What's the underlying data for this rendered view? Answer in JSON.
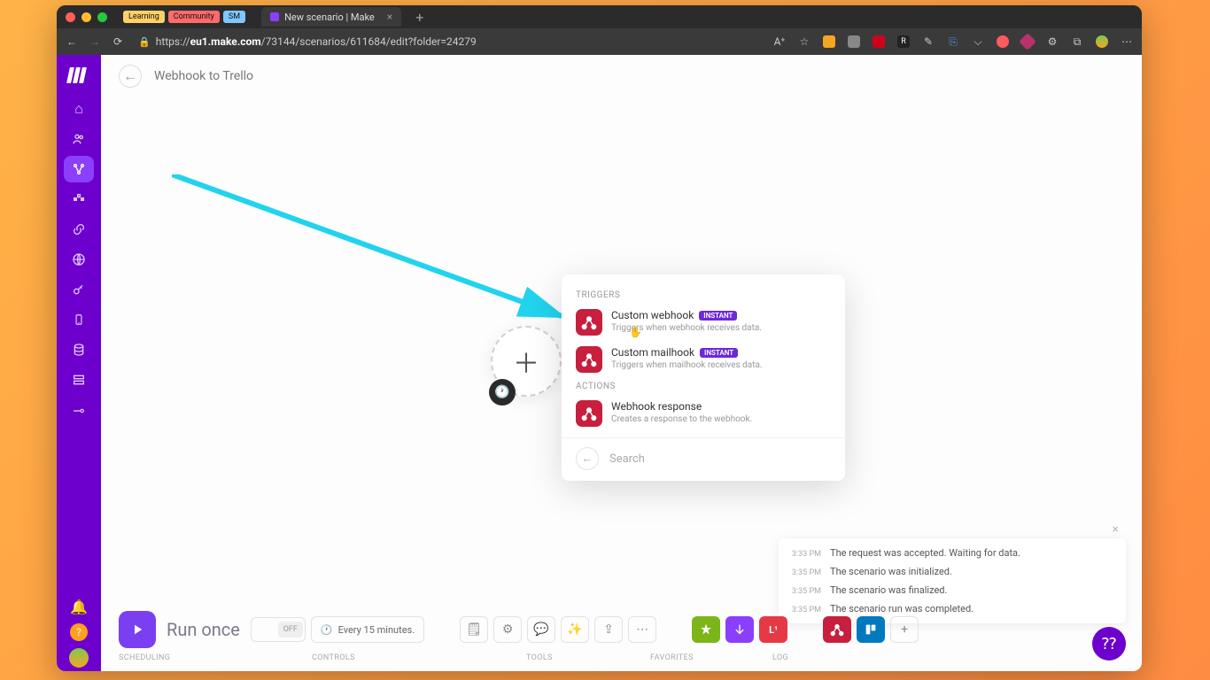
{
  "browser": {
    "bookmarks": [
      "Learning",
      "Community",
      "SM"
    ],
    "tab_title": "New scenario | Make",
    "url_prefix": "https://",
    "url_host": "eu1.make.com",
    "url_path": "/73144/scenarios/611684/edit?folder=24279"
  },
  "header": {
    "title": "Webhook to Trello"
  },
  "popup": {
    "section_triggers": "TRIGGERS",
    "section_actions": "ACTIONS",
    "badge": "INSTANT",
    "items": [
      {
        "title": "Custom webhook",
        "desc": "Triggers when webhook receives data.",
        "instant": true
      },
      {
        "title": "Custom mailhook",
        "desc": "Triggers when mailhook receives data.",
        "instant": true
      },
      {
        "title": "Webhook response",
        "desc": "Creates a response to the webhook.",
        "instant": false
      }
    ],
    "search": "Search"
  },
  "bottom": {
    "run": "Run once",
    "off": "OFF",
    "schedule": "Every 15 minutes.",
    "labels": {
      "scheduling": "SCHEDULING",
      "controls": "CONTROLS",
      "tools": "TOOLS",
      "favorites": "FAVORITES",
      "log": "LOG"
    }
  },
  "log": [
    {
      "time": "3:33 PM",
      "text": "The request was accepted. Waiting for data."
    },
    {
      "time": "3:35 PM",
      "text": "The scenario was initialized."
    },
    {
      "time": "3:35 PM",
      "text": "The scenario was finalized."
    },
    {
      "time": "3:35 PM",
      "text": "The scenario run was completed."
    }
  ]
}
